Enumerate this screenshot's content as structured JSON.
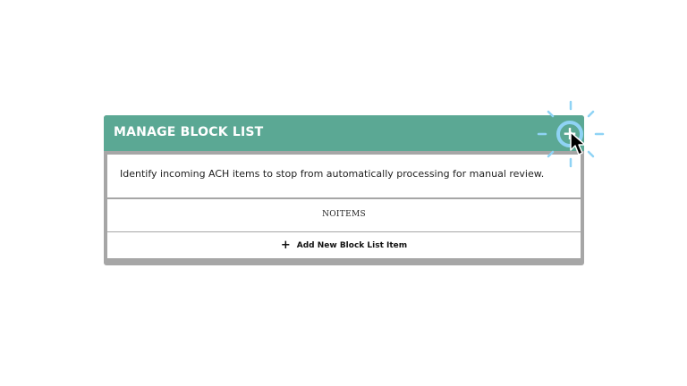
{
  "panel": {
    "title": "MANAGE BLOCK LIST",
    "add_button_icon": "plus-icon",
    "add_button_glyph": "+",
    "description": "Identify incoming ACH items to stop from automatically processing for manual review.",
    "empty_state": "NOITEMS",
    "add_item": {
      "icon": "plus-icon",
      "glyph": "+",
      "label": "Add New Block List Item"
    }
  },
  "colors": {
    "header": "#5ba894",
    "frame": "#a6a6a6",
    "highlight_ring": "#8fd3f5",
    "text": "#222222"
  }
}
